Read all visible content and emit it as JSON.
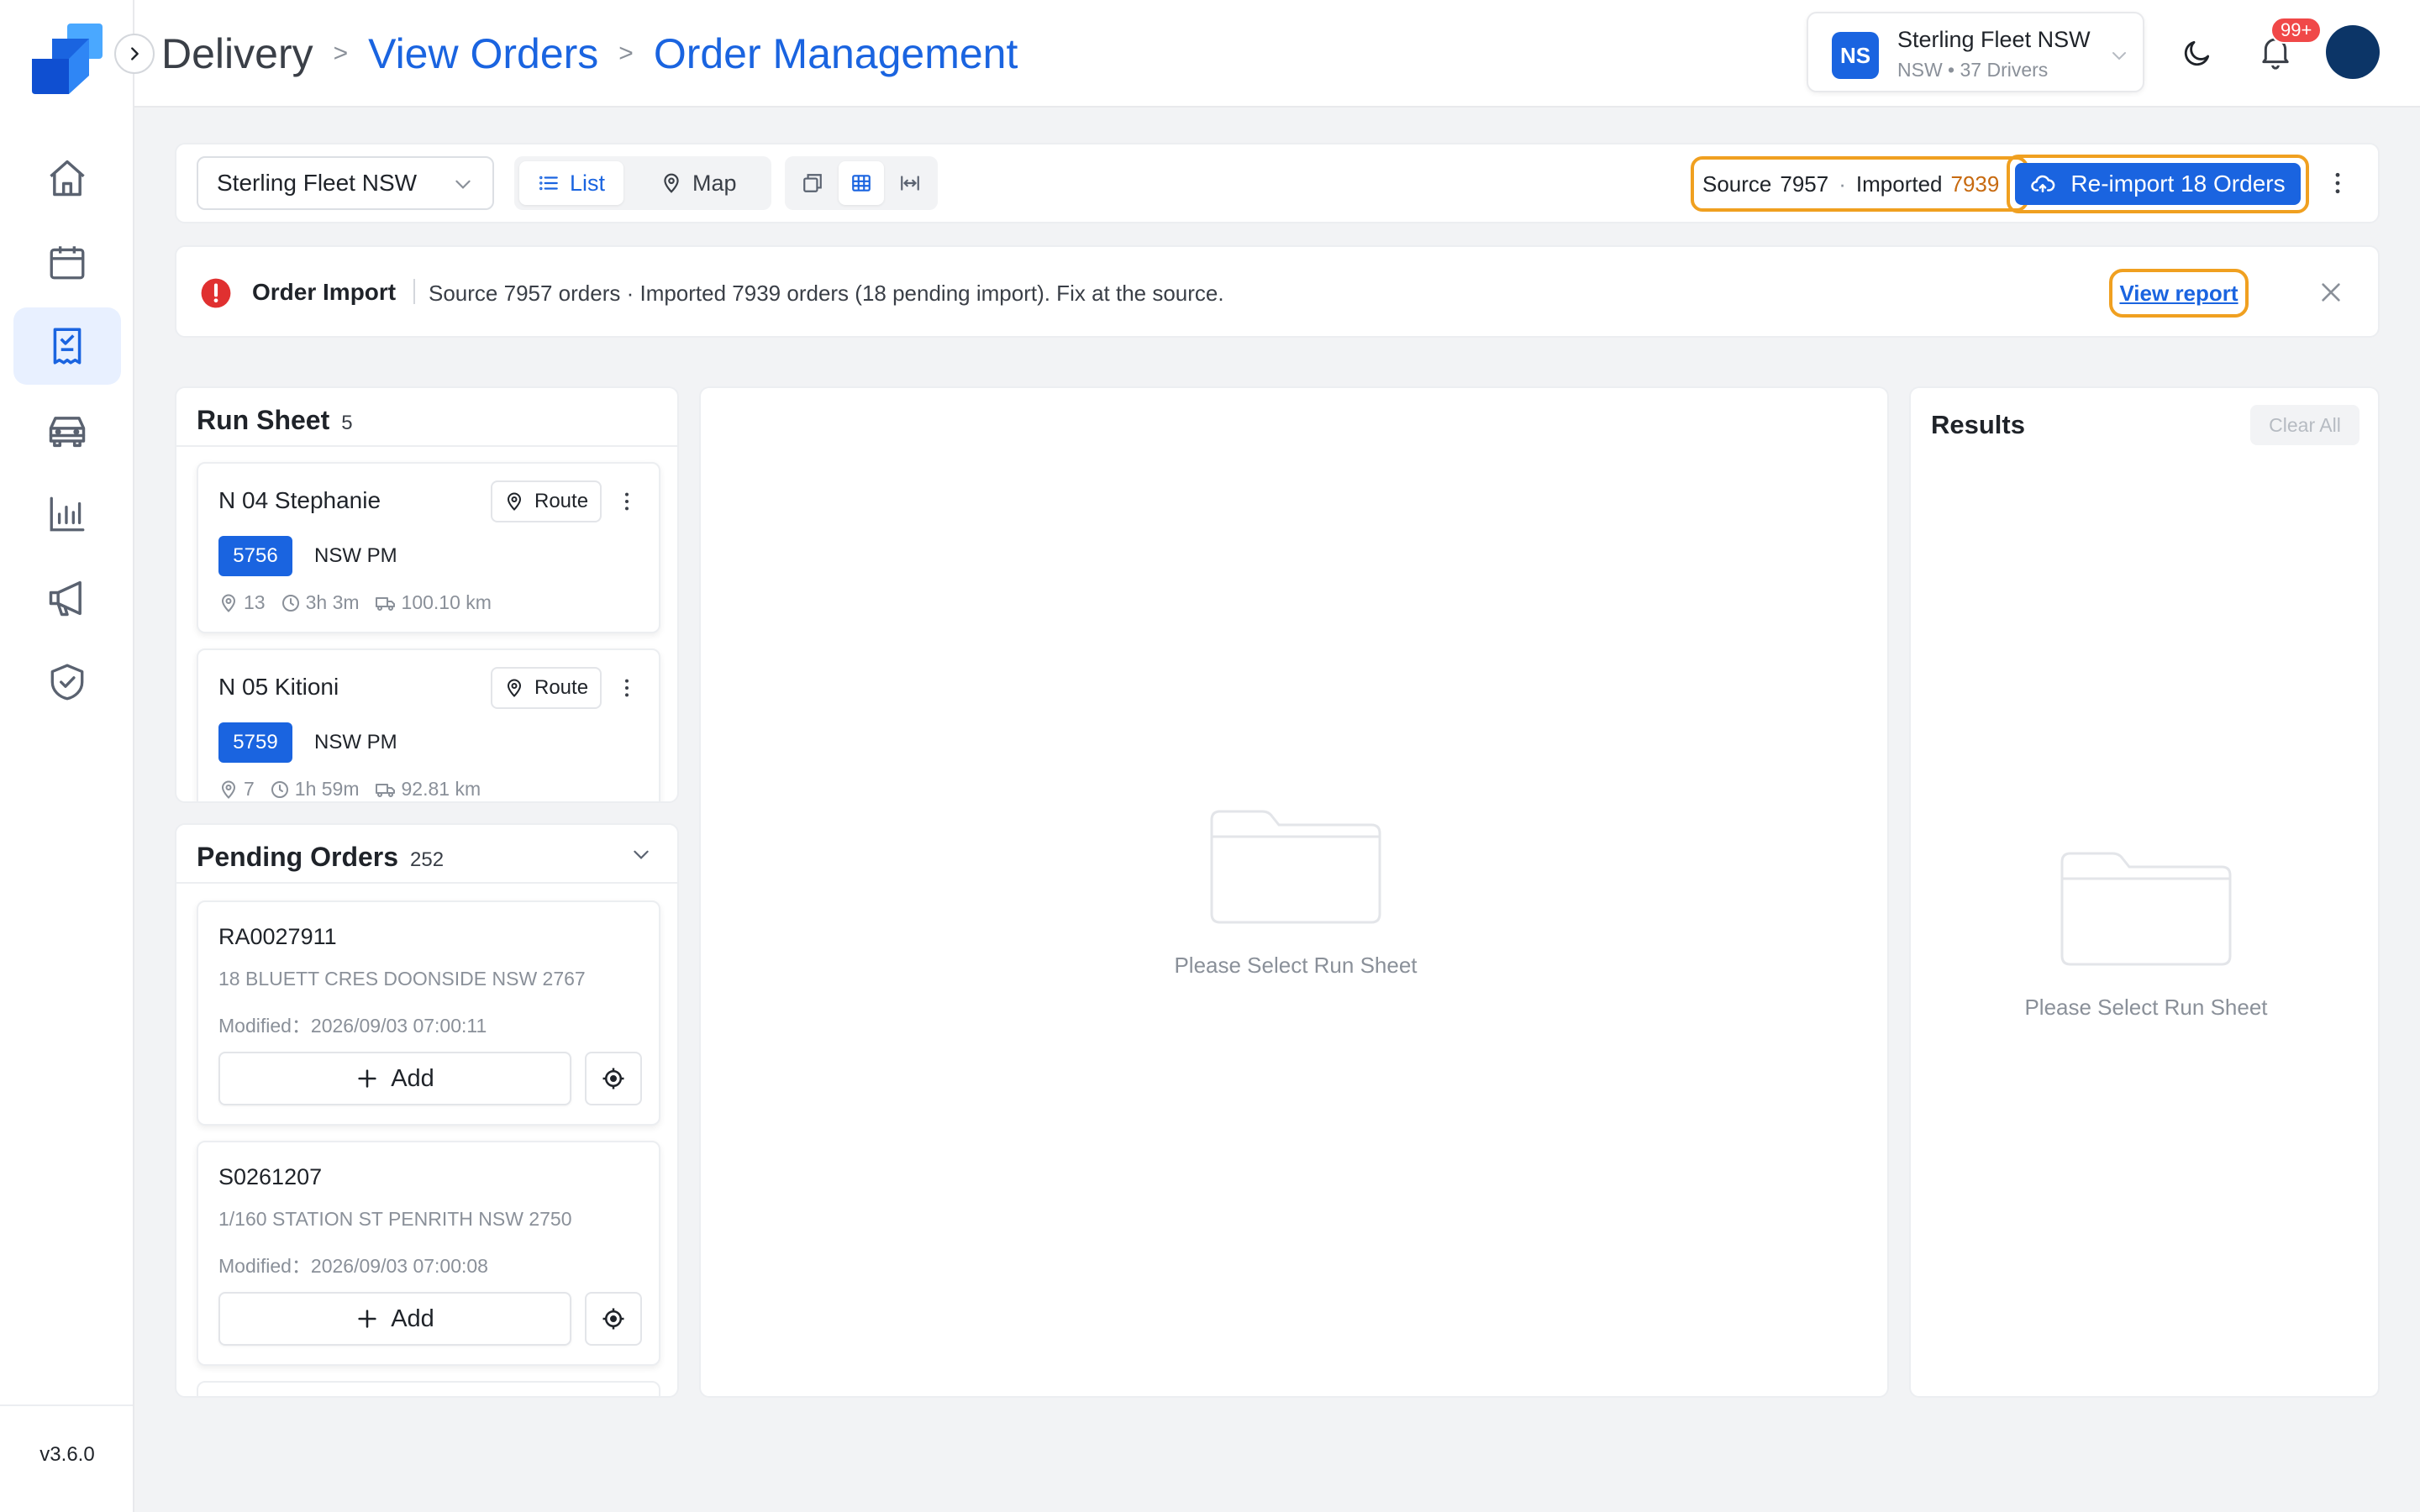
{
  "app": {
    "version": "v3.6.0"
  },
  "breadcrumb": {
    "home": "Delivery",
    "items": [
      "View Orders",
      "Order Management"
    ],
    "separator": ">"
  },
  "fleet_switch": {
    "badge": "NS",
    "name": "Sterling Fleet NSW",
    "sub": "NSW • 37 Drivers"
  },
  "notifications": {
    "badge": "99+"
  },
  "sidebar": {
    "items": [
      {
        "icon": "home-icon",
        "active": false
      },
      {
        "icon": "calendar-icon",
        "active": false
      },
      {
        "icon": "orders-icon",
        "active": true
      },
      {
        "icon": "vehicle-icon",
        "active": false
      },
      {
        "icon": "chart-icon",
        "active": false
      },
      {
        "icon": "megaphone-icon",
        "active": false
      },
      {
        "icon": "shield-icon",
        "active": false
      }
    ]
  },
  "toolbar": {
    "fleet_select": "Sterling Fleet NSW",
    "view_list": "List",
    "view_map": "Map",
    "source_label": "Source",
    "source_value": "7957",
    "dot": "·",
    "imported_label": "Imported",
    "imported_value": "7939",
    "reimport_label": "Re-import 18 Orders"
  },
  "alert": {
    "title": "Order Import",
    "message": "Source 7957 orders · Imported 7939 orders (18 pending import). Fix at the source.",
    "link": "View report"
  },
  "run_sheet": {
    "title": "Run Sheet",
    "count": "5",
    "route_label": "Route",
    "items": [
      {
        "name": "N 04 Stephanie",
        "tag": "5756",
        "shift": "NSW PM",
        "stops": "13",
        "duration": "3h 3m",
        "distance": "100.10 km"
      },
      {
        "name": "N 05 Kitioni",
        "tag": "5759",
        "shift": "NSW PM",
        "stops": "7",
        "duration": "1h 59m",
        "distance": "92.81 km"
      }
    ]
  },
  "pending_orders": {
    "title": "Pending Orders",
    "count": "252",
    "add_label": "Add",
    "items": [
      {
        "id": "RA0027911",
        "address": "18 BLUETT CRES DOONSIDE NSW 2767",
        "modified": "Modified：2026/09/03 07:00:11"
      },
      {
        "id": "S0261207",
        "address": "1/160 STATION ST PENRITH NSW 2750",
        "modified": "Modified：2026/09/03 07:00:08"
      }
    ]
  },
  "center": {
    "empty_text": "Please Select Run Sheet"
  },
  "results": {
    "title": "Results",
    "clear_label": "Clear All",
    "empty_text": "Please Select Run Sheet"
  },
  "colors": {
    "primary": "#1a64e0",
    "highlight": "#f0a020",
    "alert": "#e03030",
    "avatar": "#0c3567"
  }
}
